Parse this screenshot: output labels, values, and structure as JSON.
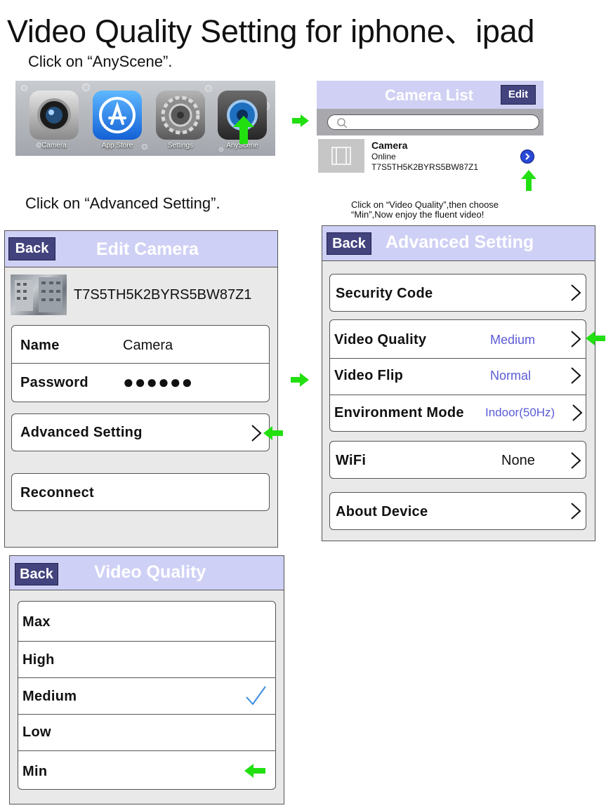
{
  "title": "Video Quality Setting for iphone、ipad",
  "steps": {
    "step1": "Click on “AnyScene”.",
    "step2": "Click on “Advanced Setting”.",
    "step3_line1": "Click on “Video Quality”,then choose",
    "step3_line2": "“Min”,Now enjoy the fluent video!"
  },
  "home_screen": {
    "apps": [
      {
        "label": "Camera",
        "icon": "camera-icon"
      },
      {
        "label": "App Store",
        "icon": "app-store-icon"
      },
      {
        "label": "Settings",
        "icon": "gear-icon"
      },
      {
        "label": "AnyScene",
        "icon": "anyscene-icon"
      }
    ]
  },
  "camera_list": {
    "title": "Camera List",
    "edit_label": "Edit",
    "search_icon": "search-icon",
    "camera": {
      "name": "Camera",
      "status": "Online",
      "uid": "T7S5TH5K2BYRS5BW87Z1"
    }
  },
  "edit_camera": {
    "back_label": "Back",
    "title": "Edit Camera",
    "uid": "T7S5TH5K2BYRS5BW87Z1",
    "fields": {
      "name_label": "Name",
      "name_value": "Camera",
      "password_label": "Password",
      "password_value": "●●●●●●"
    },
    "advanced_label": "Advanced Setting",
    "reconnect_label": "Reconnect"
  },
  "advanced_setting": {
    "back_label": "Back",
    "title": "Advanced Setting",
    "security_code": "Security Code",
    "video_quality": {
      "label": "Video Quality",
      "value": "Medium"
    },
    "video_flip": {
      "label": "Video Flip",
      "value": "Normal"
    },
    "environment_mode": {
      "label": "Environment Mode",
      "value": "Indoor(50Hz)"
    },
    "wifi": {
      "label": "WiFi",
      "value": "None"
    },
    "about": "About Device"
  },
  "video_quality": {
    "back_label": "Back",
    "title": "Video Quality",
    "options": [
      "Max",
      "High",
      "Medium",
      "Low",
      "Min"
    ],
    "selected": "Medium"
  },
  "colors": {
    "nav_bar": "#cfd0f5",
    "button": "#43437e",
    "value_text": "#5b5bd6",
    "arrow": "#22e010",
    "panel_bg": "#e9e9e9",
    "checkmark": "#3a8de0"
  }
}
